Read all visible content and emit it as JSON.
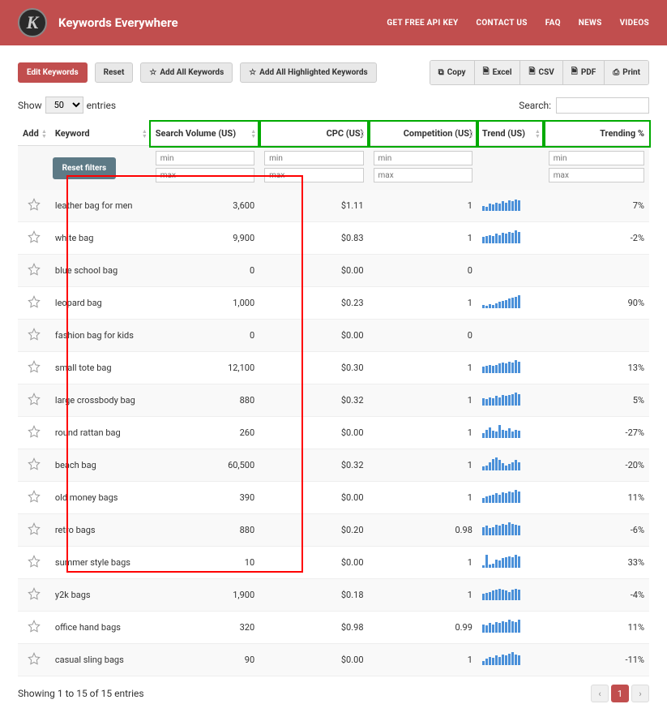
{
  "header": {
    "brand": "Keywords Everywhere",
    "logo_letter": "K",
    "nav": [
      "GET FREE API KEY",
      "CONTACT US",
      "FAQ",
      "NEWS",
      "VIDEOS"
    ]
  },
  "toolbar": {
    "edit": "Edit Keywords",
    "reset": "Reset",
    "add_all": "Add All Keywords",
    "add_highlighted": "Add All Highlighted Keywords",
    "copy": "Copy",
    "excel": "Excel",
    "csv": "CSV",
    "pdf": "PDF",
    "print": "Print"
  },
  "controls": {
    "show_label": "Show",
    "entries_label": "entries",
    "entries_value": "50",
    "search_label": "Search:"
  },
  "columns": {
    "add": "Add",
    "keyword": "Keyword",
    "volume": "Search Volume (US)",
    "cpc": "CPC (US)",
    "competition": "Competition (US)",
    "trend": "Trend (US)",
    "trending": "Trending %"
  },
  "filters": {
    "reset": "Reset filters",
    "min": "min",
    "max": "max"
  },
  "rows": [
    {
      "keyword": "leather bag for men",
      "volume": "3,600",
      "cpc": "$1.11",
      "comp": "1",
      "trending": "7%",
      "spark": [
        5,
        4,
        7,
        6,
        8,
        7,
        9,
        8,
        10,
        9,
        11,
        10
      ]
    },
    {
      "keyword": "white bag",
      "volume": "9,900",
      "cpc": "$0.83",
      "comp": "1",
      "trending": "-2%",
      "spark": [
        6,
        7,
        8,
        7,
        9,
        8,
        10,
        9,
        11,
        10,
        12,
        11
      ]
    },
    {
      "keyword": "blue school bag",
      "volume": "0",
      "cpc": "$0.00",
      "comp": "0",
      "trending": "",
      "spark": []
    },
    {
      "keyword": "leopard bag",
      "volume": "1,000",
      "cpc": "$0.23",
      "comp": "1",
      "trending": "90%",
      "spark": [
        3,
        2,
        4,
        3,
        5,
        6,
        7,
        8,
        9,
        10,
        11,
        12
      ]
    },
    {
      "keyword": "fashion bag for kids",
      "volume": "0",
      "cpc": "$0.00",
      "comp": "0",
      "trending": "",
      "spark": []
    },
    {
      "keyword": "small tote bag",
      "volume": "12,100",
      "cpc": "$0.30",
      "comp": "1",
      "trending": "13%",
      "spark": [
        6,
        7,
        8,
        7,
        8,
        9,
        10,
        9,
        11,
        10,
        12,
        11
      ]
    },
    {
      "keyword": "large crossbody bag",
      "volume": "880",
      "cpc": "$0.32",
      "comp": "1",
      "trending": "5%",
      "spark": [
        7,
        6,
        8,
        7,
        9,
        8,
        10,
        9,
        10,
        11,
        12,
        11
      ]
    },
    {
      "keyword": "round rattan bag",
      "volume": "260",
      "cpc": "$0.00",
      "comp": "1",
      "trending": "-27%",
      "spark": [
        5,
        8,
        10,
        7,
        6,
        12,
        8,
        7,
        9,
        6,
        8,
        7
      ]
    },
    {
      "keyword": "beach bag",
      "volume": "60,500",
      "cpc": "$0.32",
      "comp": "1",
      "trending": "-20%",
      "spark": [
        4,
        5,
        8,
        11,
        12,
        10,
        7,
        5,
        6,
        8,
        10,
        8
      ]
    },
    {
      "keyword": "old money bags",
      "volume": "390",
      "cpc": "$0.00",
      "comp": "1",
      "trending": "11%",
      "spark": [
        5,
        6,
        7,
        8,
        9,
        8,
        10,
        9,
        11,
        10,
        12,
        11
      ]
    },
    {
      "keyword": "retro bags",
      "volume": "880",
      "cpc": "$0.20",
      "comp": "0.98",
      "trending": "-6%",
      "spark": [
        8,
        9,
        7,
        8,
        10,
        9,
        11,
        10,
        12,
        11,
        10,
        9
      ]
    },
    {
      "keyword": "summer style bags",
      "volume": "10",
      "cpc": "$0.00",
      "comp": "1",
      "trending": "33%",
      "spark": [
        2,
        12,
        3,
        4,
        8,
        7,
        9,
        10,
        11,
        10,
        12,
        11
      ]
    },
    {
      "keyword": "y2k bags",
      "volume": "1,900",
      "cpc": "$0.18",
      "comp": "1",
      "trending": "-4%",
      "spark": [
        6,
        7,
        8,
        9,
        10,
        11,
        10,
        9,
        8,
        10,
        11,
        10
      ]
    },
    {
      "keyword": "office hand bags",
      "volume": "320",
      "cpc": "$0.98",
      "comp": "0.99",
      "trending": "11%",
      "spark": [
        8,
        7,
        9,
        8,
        10,
        9,
        11,
        10,
        12,
        11,
        10,
        12
      ]
    },
    {
      "keyword": "casual sling bags",
      "volume": "90",
      "cpc": "$0.00",
      "comp": "1",
      "trending": "-11%",
      "spark": [
        4,
        6,
        8,
        7,
        9,
        8,
        10,
        9,
        11,
        12,
        10,
        9
      ]
    }
  ],
  "footer": {
    "info": "Showing 1 to 15 of 15 entries",
    "page": "1"
  },
  "chart_data": {
    "type": "table",
    "title": "Keywords Everywhere — keyword metrics",
    "columns": [
      "Keyword",
      "Search Volume (US)",
      "CPC (US)",
      "Competition (US)",
      "Trending %"
    ],
    "rows": [
      [
        "leather bag for men",
        3600,
        1.11,
        1,
        7
      ],
      [
        "white bag",
        9900,
        0.83,
        1,
        -2
      ],
      [
        "blue school bag",
        0,
        0.0,
        0,
        null
      ],
      [
        "leopard bag",
        1000,
        0.23,
        1,
        90
      ],
      [
        "fashion bag for kids",
        0,
        0.0,
        0,
        null
      ],
      [
        "small tote bag",
        12100,
        0.3,
        1,
        13
      ],
      [
        "large crossbody bag",
        880,
        0.32,
        1,
        5
      ],
      [
        "round rattan bag",
        260,
        0.0,
        1,
        -27
      ],
      [
        "beach bag",
        60500,
        0.32,
        1,
        -20
      ],
      [
        "old money bags",
        390,
        0.0,
        1,
        11
      ],
      [
        "retro bags",
        880,
        0.2,
        0.98,
        -6
      ],
      [
        "summer style bags",
        10,
        0.0,
        1,
        33
      ],
      [
        "y2k bags",
        1900,
        0.18,
        1,
        -4
      ],
      [
        "office hand bags",
        320,
        0.98,
        0.99,
        11
      ],
      [
        "casual sling bags",
        90,
        0.0,
        1,
        -11
      ]
    ]
  }
}
